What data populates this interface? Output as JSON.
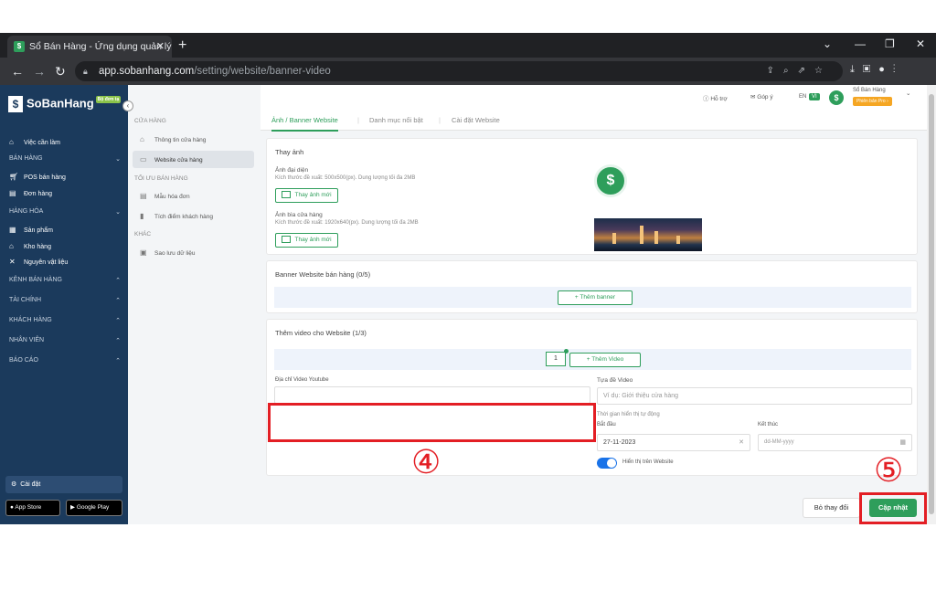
{
  "browser": {
    "tab_title": "Sổ Bán Hàng - Ứng dụng quản lý",
    "url_domain": "app.sobanhang.com",
    "url_path": "/setting/website/banner-video"
  },
  "sidebar": {
    "logo_text": "SoBanHang",
    "logo_badge": "Bộ đơn tạ",
    "items": {
      "todo": "Việc cần làm",
      "sales_section": "BÁN HÀNG",
      "pos": "POS bán hàng",
      "orders": "Đơn hàng",
      "goods_section": "HÀNG HÓA",
      "products": "Sản phẩm",
      "warehouse": "Kho hàng",
      "materials": "Nguyên vật liệu",
      "channels_section": "KÊNH BÁN HÀNG",
      "finance_section": "TÀI CHÍNH",
      "customers_section": "KHÁCH HÀNG",
      "staff_section": "NHÂN VIÊN",
      "reports_section": "BÁO CÁO"
    },
    "settings": "Cài đặt",
    "app_store": "App Store",
    "google_play": "Google Play"
  },
  "submenu": {
    "store_section": "CỬA HÀNG",
    "store_info": "Thông tin cửa hàng",
    "store_website": "Website cửa hàng",
    "optimize_section": "TỐI ƯU BÁN HÀNG",
    "invoice_template": "Mẫu hóa đơn",
    "loyalty": "Tích điểm khách hàng",
    "other_section": "KHÁC",
    "backup": "Sao lưu dữ liệu"
  },
  "topbar": {
    "support": "Hỗ trợ",
    "feedback": "Góp ý",
    "lang_en": "EN",
    "lang_vi": "VI",
    "user_name": "Sổ Bán Hàng",
    "plan_badge": "Phiên bản Pro"
  },
  "page_tabs": {
    "banner": "Ảnh / Banner Website",
    "featured": "Danh mục nổi bật",
    "website_settings": "Cài đặt Website"
  },
  "images_card": {
    "title": "Thay ảnh",
    "avatar_label": "Ảnh đại diện",
    "avatar_hint": "Kích thước đề xuất: 500x500(px). Dung lượng tối đa 2MB",
    "avatar_btn": "Thay ảnh mới",
    "cover_label": "Ảnh bìa cửa hàng",
    "cover_hint": "Kích thước đề xuất: 1920x640(px). Dung lượng tối đa 2MB",
    "cover_btn": "Thay ảnh mới"
  },
  "banner_card": {
    "title": "Banner Website bán hàng (0/5)",
    "add_btn": "+ Thêm banner"
  },
  "video_card": {
    "title": "Thêm video cho Website (1/3)",
    "video_index": "1",
    "add_btn": "+ Thêm Video",
    "url_label": "Địa chỉ Video Youtube",
    "url_value": "",
    "title_label": "Tựa đề Video",
    "title_placeholder": "Ví dụ: Giới thiệu cửa hàng",
    "schedule_label": "Thời gian hiển thị tự động",
    "start_label": "Bắt đầu",
    "start_value": "27-11-2023",
    "end_label": "Kết thúc",
    "end_placeholder": "dd-MM-yyyy",
    "show_label": "Hiển thị trên Website",
    "show_on": true
  },
  "footer": {
    "cancel_btn": "Bỏ thay đổi",
    "save_btn": "Cập nhật"
  },
  "annotations": {
    "step4": "④",
    "step5": "⑤"
  },
  "colors": {
    "primary_green": "#2e9e5b",
    "sidebar_navy": "#1b3a5c",
    "highlight_red": "#e31e24",
    "pro_orange": "#f5a623"
  }
}
